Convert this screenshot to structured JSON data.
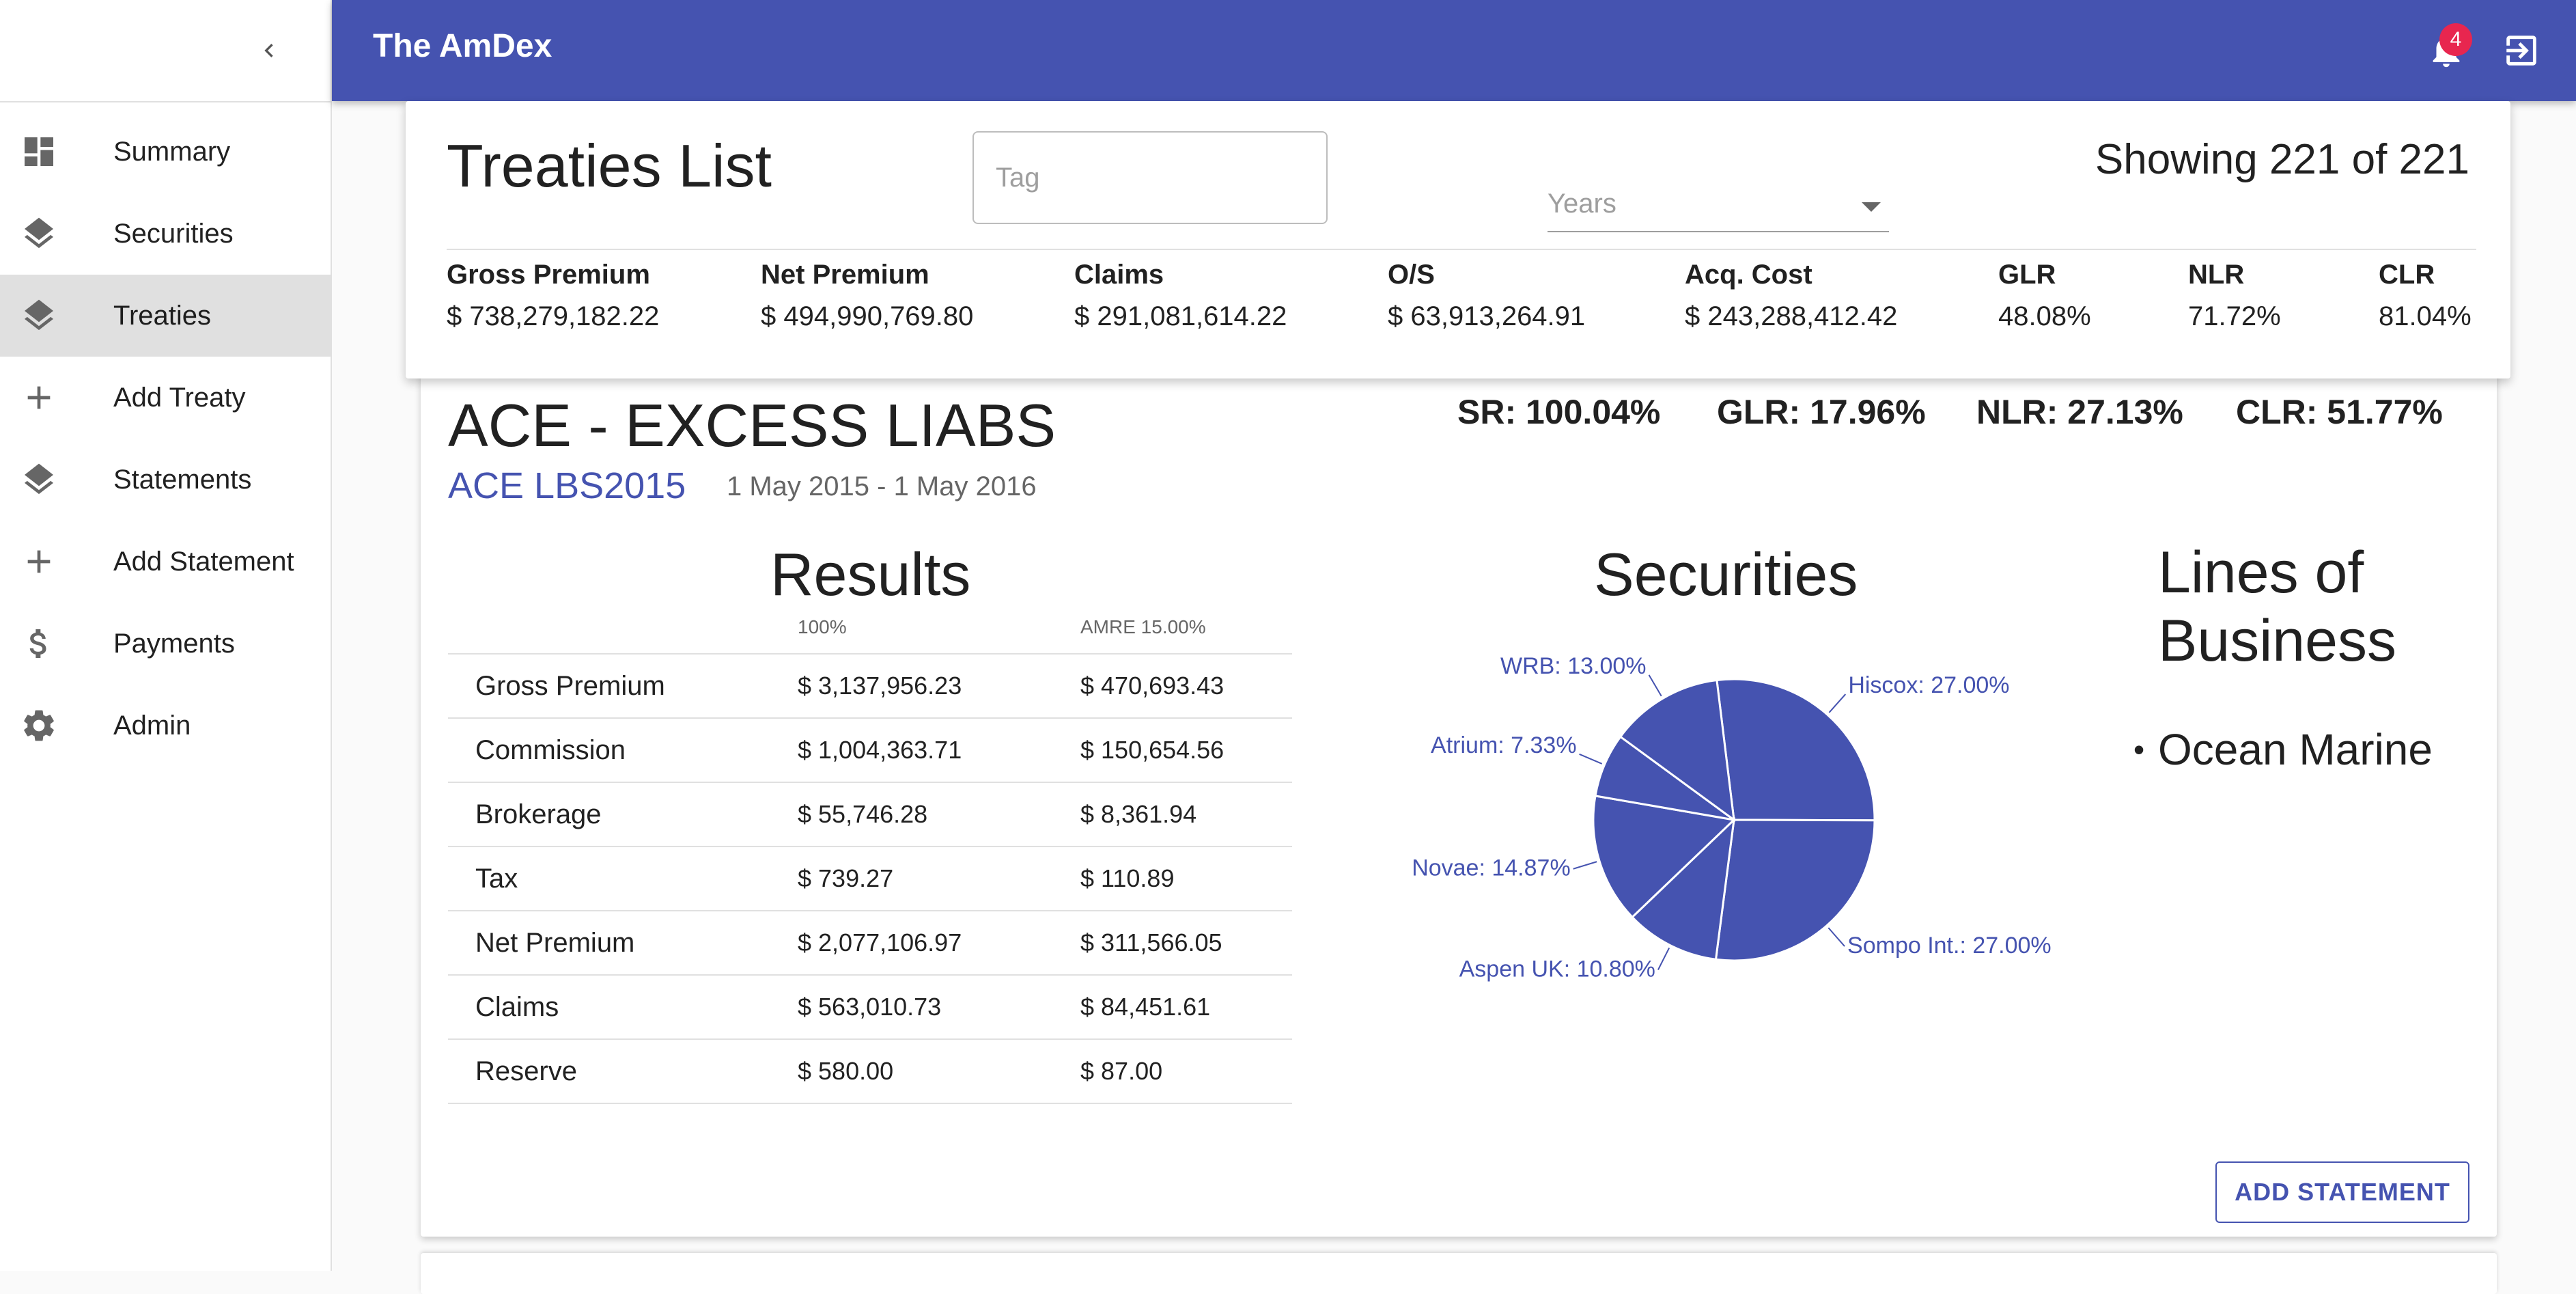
{
  "app": {
    "title": "The AmDex",
    "notifications": "4"
  },
  "sidebar": {
    "items": [
      {
        "label": "Summary",
        "icon": "dashboard-icon",
        "active": false
      },
      {
        "label": "Securities",
        "icon": "layers-icon",
        "active": false
      },
      {
        "label": "Treaties",
        "icon": "layers-icon",
        "active": true
      },
      {
        "label": "Add Treaty",
        "icon": "plus-icon",
        "active": false
      },
      {
        "label": "Statements",
        "icon": "layers-icon",
        "active": false
      },
      {
        "label": "Add Statement",
        "icon": "plus-icon",
        "active": false
      },
      {
        "label": "Payments",
        "icon": "dollar-icon",
        "active": false
      },
      {
        "label": "Admin",
        "icon": "gear-icon",
        "active": false
      }
    ]
  },
  "summary": {
    "title": "Treaties List",
    "tag_placeholder": "Tag",
    "years_label": "Years",
    "showing": "Showing 221 of 221",
    "totals": [
      {
        "label": "Gross Premium",
        "value": "$ 738,279,182.22"
      },
      {
        "label": "Net Premium",
        "value": "$ 494,990,769.80"
      },
      {
        "label": "Claims",
        "value": "$ 291,081,614.22"
      },
      {
        "label": "O/S",
        "value": "$ 63,913,264.91"
      },
      {
        "label": "Acq. Cost",
        "value": "$ 243,288,412.42"
      },
      {
        "label": "GLR",
        "value": "48.08%"
      },
      {
        "label": "NLR",
        "value": "71.72%"
      },
      {
        "label": "CLR",
        "value": "81.04%"
      }
    ]
  },
  "treaty": {
    "name": "ACE - EXCESS LIABS",
    "code": "ACE LBS2015",
    "dates": "1 May 2015 - 1 May 2016",
    "ratios": [
      "SR: 100.04%",
      "GLR: 17.96%",
      "NLR: 27.13%",
      "CLR: 51.77%"
    ],
    "results_title": "Results",
    "results_columns": [
      "",
      "100%",
      "AMRE 15.00%"
    ],
    "results_rows": [
      [
        "Gross Premium",
        "$ 3,137,956.23",
        "$ 470,693.43"
      ],
      [
        "Commission",
        "$ 1,004,363.71",
        "$ 150,654.56"
      ],
      [
        "Brokerage",
        "$ 55,746.28",
        "$ 8,361.94"
      ],
      [
        "Tax",
        "$ 739.27",
        "$ 110.89"
      ],
      [
        "Net Premium",
        "$ 2,077,106.97",
        "$ 311,566.05"
      ],
      [
        "Claims",
        "$ 563,010.73",
        "$ 84,451.61"
      ],
      [
        "Reserve",
        "$ 580.00",
        "$ 87.00"
      ]
    ],
    "securities_title": "Securities",
    "lob_title": "Lines of Business",
    "lob_items": [
      "Ocean Marine"
    ],
    "add_statement_label": "ADD STATEMENT"
  },
  "chart_data": {
    "type": "pie",
    "categories": [
      "Hiscox",
      "Sompo Int.",
      "Aspen UK",
      "Novae",
      "Atrium",
      "WRB"
    ],
    "labels": [
      "Hiscox: 27.00%",
      "Sompo Int.: 27.00%",
      "Aspen UK: 10.80%",
      "Novae: 14.87%",
      "Atrium: 7.33%",
      "WRB: 13.00%"
    ],
    "values": [
      27.0,
      27.0,
      10.8,
      14.87,
      7.33,
      13.0
    ],
    "color": "#4553b0"
  }
}
